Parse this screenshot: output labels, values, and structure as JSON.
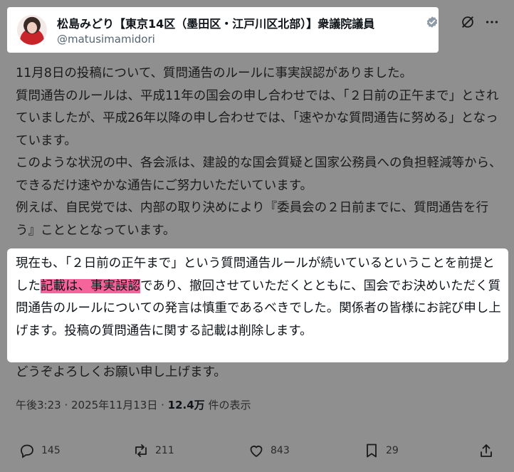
{
  "author": {
    "display_name": "松島みどり【東京14区（墨田区・江戸川区北部）】衆議院議員",
    "handle": "@matusimamidori",
    "verified_icon": "verified-badge-icon"
  },
  "post": {
    "paragraph1": "11月8日の投稿について、質問通告のルールに事実誤認がありました。\n質問通告のルールは、平成11年の国会の申し合わせでは、「２日前の正午まで」とされていましたが、平成26年以降の申し合わせでは、「速やかな質問通告に努める」となっています。\nこのような状況の中、各会派は、建設的な国会質疑と国家公務員への負担軽減等から、できるだけ速やかな通告にご努力いただいています。\n例えば、自民党では、内部の取り決めにより『委員会の２日前までに、質問通告を行う』ことととなっています。",
    "paragraph2_before": "現在も、「２日前の正午まで」という質問通告ルールが続いているということを前提とした",
    "paragraph2_highlight": "記載は、事実誤認",
    "paragraph2_after": "であり、撤回させていただくとともに、国会でお決めいただく質問通告のルールについての発言は慎重であるべきでした。関係者の皆様にお詫び申し上げます。投稿の質問通告に関する記載は削除します。",
    "closing": "どうぞよろしくお願い申し上げます。"
  },
  "meta": {
    "timestamp": "午後3:23 · 2025年11月13日 · ",
    "views_count": "12.4万",
    "views_label": " 件の表示"
  },
  "actions": {
    "replies": "145",
    "reposts": "211",
    "likes": "843",
    "bookmarks": "29"
  },
  "colors": {
    "highlight": "#f5649a",
    "background_dim": "#8f8f8f"
  }
}
